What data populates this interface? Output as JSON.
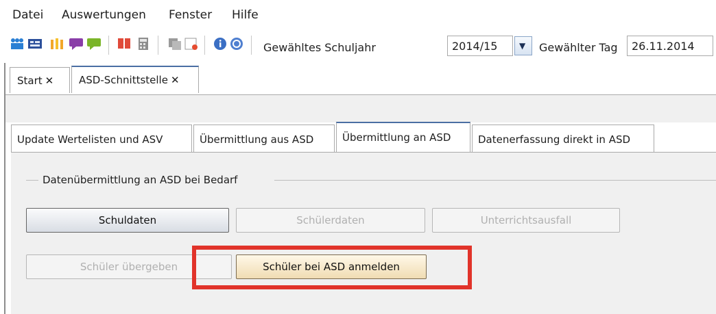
{
  "menu": {
    "items": [
      {
        "label": "Datei"
      },
      {
        "label": "Auswertungen"
      },
      {
        "label": "Fenster"
      },
      {
        "label": "Hilfe"
      }
    ]
  },
  "toolbar": {
    "schuljahr_label": "Gewähltes Schuljahr",
    "schuljahr_value": "2014/15",
    "tag_label": "Gewählter Tag",
    "tag_value": "26.11.2014",
    "icons": [
      "people-blue-icon",
      "table-icon",
      "people-yellow-icon",
      "chat-purple-icon",
      "chat-green-icon",
      "book-red-icon",
      "calculator-icon",
      "copy-icon",
      "form-red-icon",
      "info-icon",
      "help-icon"
    ]
  },
  "tabs": [
    {
      "label": "Start",
      "close": "✕"
    },
    {
      "label": "ASD-Schnittstelle",
      "close": "✕"
    }
  ],
  "subtabs": [
    {
      "label": "Update Wertelisten und ASV"
    },
    {
      "label": "Übermittlung aus ASD"
    },
    {
      "label": "Übermittlung an ASD"
    },
    {
      "label": "Datenerfassung direkt in ASD"
    }
  ],
  "group": {
    "title": "Datenübermittlung an ASD bei Bedarf",
    "buttons": {
      "schuldaten": "Schuldaten",
      "schuelerdaten": "Schülerdaten",
      "unterrichtsausfall": "Unterrichtsausfall",
      "schueler_uebergeben": "Schüler übergeben",
      "schueler_anmelden": "Schüler bei ASD anmelden"
    }
  },
  "colors": {
    "highlight_box": "#e1332a",
    "active_tab_border": "#4a6ea3"
  }
}
